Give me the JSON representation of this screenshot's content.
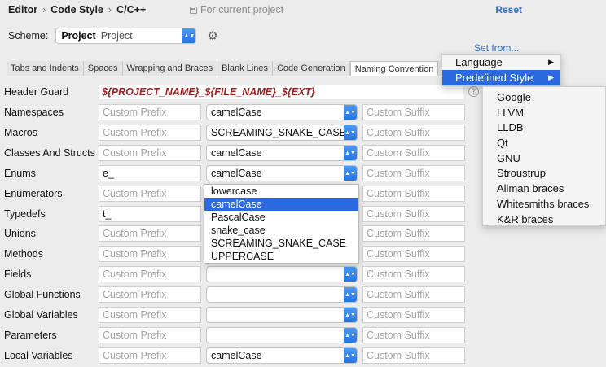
{
  "header": {
    "breadcrumb": [
      "Editor",
      "Code Style",
      "C/C++"
    ],
    "for_project": "For current project",
    "reset": "Reset"
  },
  "scheme": {
    "label": "Scheme:",
    "value_bold": "Project",
    "value": "Project"
  },
  "set_from": "Set from...",
  "tabs": [
    {
      "label": "Tabs and Indents",
      "active": false
    },
    {
      "label": "Spaces",
      "active": false
    },
    {
      "label": "Wrapping and Braces",
      "active": false
    },
    {
      "label": "Blank Lines",
      "active": false
    },
    {
      "label": "Code Generation",
      "active": false
    },
    {
      "label": "Naming Convention",
      "active": true
    },
    {
      "label": "New Fil",
      "active": false
    }
  ],
  "header_guard": {
    "label": "Header Guard",
    "value": "${PROJECT_NAME}_${FILE_NAME}_${EXT}"
  },
  "rows": [
    {
      "label": "Namespaces",
      "prefix": "",
      "style": "camelCase",
      "suffix": ""
    },
    {
      "label": "Macros",
      "prefix": "",
      "style": "SCREAMING_SNAKE_CASE",
      "suffix": ""
    },
    {
      "label": "Classes And Structs",
      "prefix": "",
      "style": "camelCase",
      "suffix": ""
    },
    {
      "label": "Enums",
      "prefix": "e_",
      "style": "camelCase",
      "suffix": ""
    },
    {
      "label": "Enumerators",
      "prefix": "",
      "style": "PascalCase",
      "suffix": ""
    },
    {
      "label": "Typedefs",
      "prefix": "t_",
      "style": "camelCase",
      "suffix": ""
    },
    {
      "label": "Unions",
      "prefix": "",
      "style": "camelCase",
      "suffix": ""
    },
    {
      "label": "Methods",
      "prefix": "",
      "style": "camelCase",
      "suffix": ""
    },
    {
      "label": "Fields",
      "prefix": "",
      "style": "",
      "suffix": ""
    },
    {
      "label": "Global Functions",
      "prefix": "",
      "style": "",
      "suffix": ""
    },
    {
      "label": "Global Variables",
      "prefix": "",
      "style": "",
      "suffix": ""
    },
    {
      "label": "Parameters",
      "prefix": "",
      "style": "",
      "suffix": ""
    },
    {
      "label": "Local Variables",
      "prefix": "",
      "style": "camelCase",
      "suffix": ""
    }
  ],
  "placeholders": {
    "prefix": "Custom Prefix",
    "suffix": "Custom Suffix"
  },
  "case_dropdown": {
    "options": [
      "lowercase",
      "camelCase",
      "PascalCase",
      "snake_case",
      "SCREAMING_SNAKE_CASE",
      "UPPERCASE"
    ],
    "selected": "camelCase"
  },
  "set_from_menu": {
    "items": [
      {
        "label": "Language",
        "highlight": false
      },
      {
        "label": "Predefined Style",
        "highlight": true
      }
    ]
  },
  "predefined_styles": [
    "Google",
    "LLVM",
    "LLDB",
    "Qt",
    "GNU",
    "Stroustrup",
    "Allman braces",
    "Whitesmiths braces",
    "K&R braces"
  ],
  "colors": {
    "accent": "#2a69e0",
    "link": "#2f6cd1",
    "guard_text": "#9c2121"
  }
}
